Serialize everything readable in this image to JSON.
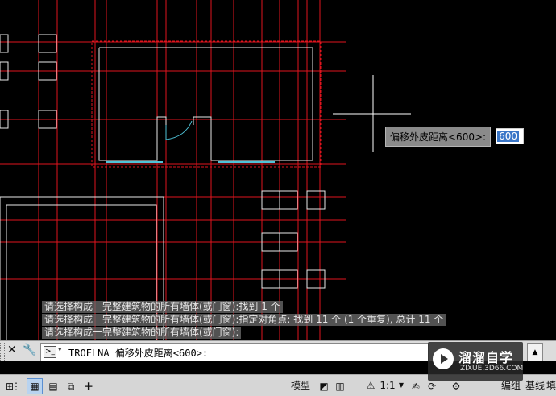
{
  "command_history": [
    "请选择构成一完整建筑物的所有墙体(或门窗):找到 1 个",
    "请选择构成一完整建筑物的所有墙体(或门窗):指定对角点: 找到 11 个 (1 个重复), 总计 11 个",
    "请选择构成一完整建筑物的所有墙体(或门窗):"
  ],
  "cursor_tooltip": {
    "label": "偏移外皮距离<600>:",
    "value": "600"
  },
  "command_line": {
    "close_icon": "✕",
    "customize_icon": "🔧",
    "prompt_icon": ">_",
    "dropdown_icon": "▾",
    "text": "TROFLNA 偏移外皮距离<600>:",
    "scroll_icon": "▲"
  },
  "status_bar": {
    "model_label": "模型",
    "annotation_scale": "1:1",
    "edit_label": "编组",
    "baseline_label": "基线",
    "extra_label": "填"
  },
  "watermark": {
    "title": "溜溜自学",
    "subtitle": "ZIXUE.3D66.COM"
  },
  "colors": {
    "background": "#000000",
    "gridline": "#e0141e",
    "wall": "#e8e8e8",
    "window": "#4fc3d8",
    "crosshair": "#ffffff"
  }
}
